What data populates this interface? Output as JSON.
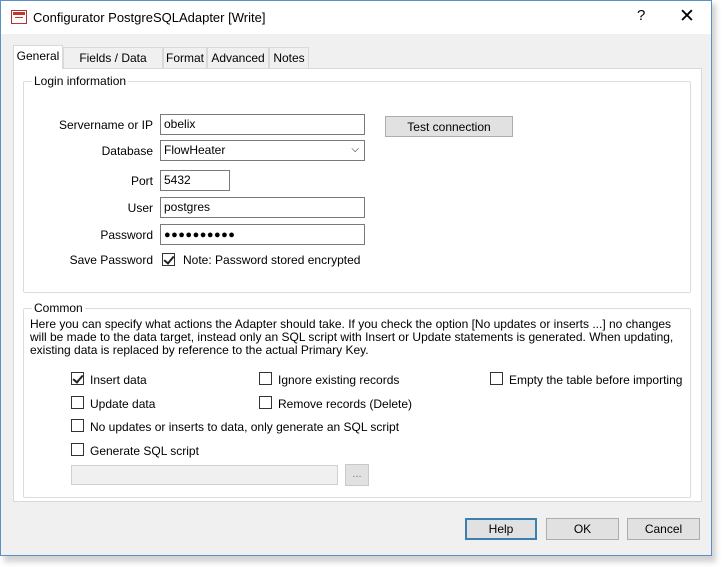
{
  "window": {
    "title": "Configurator PostgreSQLAdapter [Write]",
    "help_glyph": "?",
    "close_glyph": "✕"
  },
  "tabs": [
    {
      "label": "General",
      "active": true
    },
    {
      "label": "Fields / Data types",
      "active": false
    },
    {
      "label": "Format",
      "active": false
    },
    {
      "label": "Advanced",
      "active": false
    },
    {
      "label": "Notes",
      "active": false
    }
  ],
  "login": {
    "group_label": "Login information",
    "servername_label": "Servername or IP",
    "servername_value": "obelix",
    "database_label": "Database",
    "database_value": "FlowHeater",
    "port_label": "Port",
    "port_value": "5432",
    "user_label": "User",
    "user_value": "postgres",
    "password_label": "Password",
    "password_value": "●●●●●●●●●●",
    "save_password_label": "Save Password",
    "save_password_checked": true,
    "save_password_note": "Note: Password stored encrypted",
    "test_connection_label": "Test connection"
  },
  "common": {
    "group_label": "Common",
    "description": "Here you can specify what actions the Adapter should take. If you check the option [No updates or inserts ...] no changes will be made to the data target, instead only an SQL script with Insert or Update statements is generated. When updating, existing data is replaced by reference to the actual Primary Key.",
    "options": {
      "insert_data": {
        "label": "Insert data",
        "checked": true
      },
      "update_data": {
        "label": "Update data",
        "checked": false
      },
      "ignore_existing": {
        "label": "Ignore existing records",
        "checked": false
      },
      "remove_records": {
        "label": "Remove records (Delete)",
        "checked": false
      },
      "empty_table": {
        "label": "Empty the table before importing",
        "checked": false
      },
      "no_updates": {
        "label": "No updates or inserts to data, only generate an SQL script",
        "checked": false
      },
      "generate_sql": {
        "label": "Generate SQL script",
        "checked": false
      }
    },
    "script_path_value": "",
    "browse_label": "..."
  },
  "footer": {
    "help_label": "Help",
    "ok_label": "OK",
    "cancel_label": "Cancel"
  }
}
